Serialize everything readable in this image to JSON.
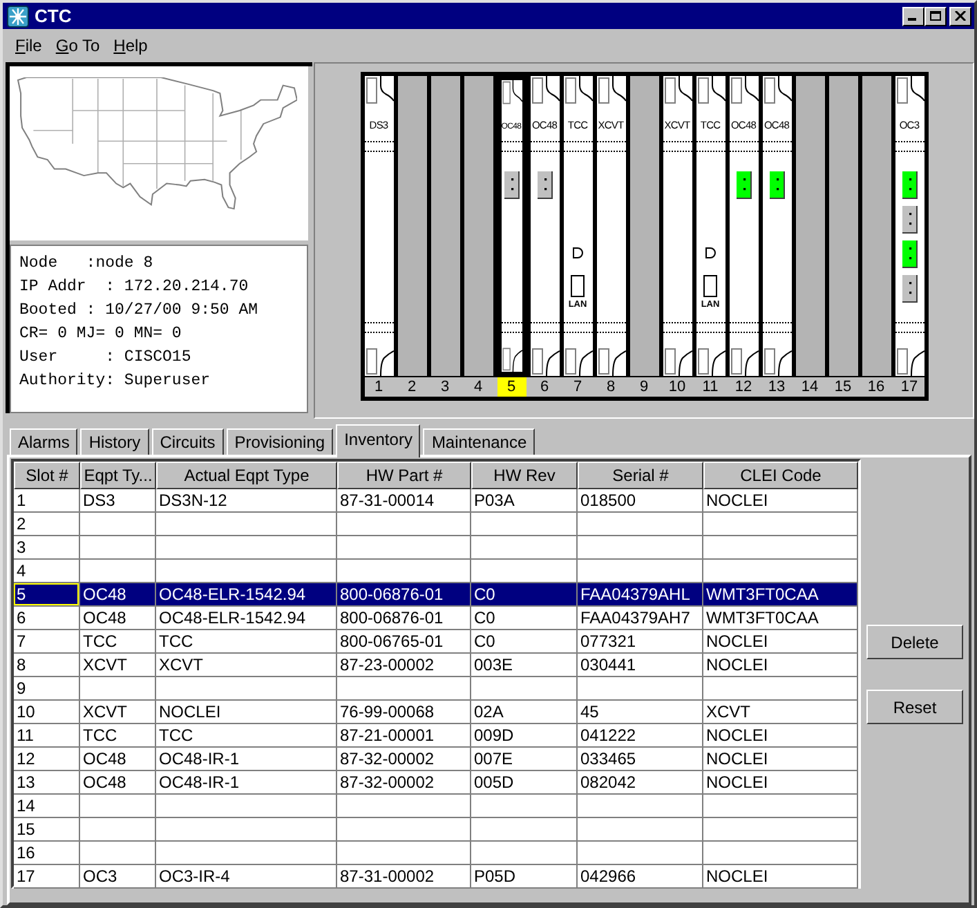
{
  "window": {
    "title": "CTC"
  },
  "menu": [
    "File",
    "Go To",
    "Help"
  ],
  "node_info": [
    "Node   :node 8",
    "IP Addr  : 172.20.214.70",
    "Booted : 10/27/00 9:50 AM",
    "CR= 0 MJ= 0 MN= 0",
    "User     : CISCO15",
    "Authority: Superuser"
  ],
  "shelf": {
    "slots": [
      {
        "number": "1",
        "kind": "card",
        "label": "DS3",
        "selected": false
      },
      {
        "number": "2",
        "kind": "empty",
        "selected": false
      },
      {
        "number": "3",
        "kind": "empty",
        "selected": false
      },
      {
        "number": "4",
        "kind": "empty",
        "selected": false
      },
      {
        "number": "5",
        "kind": "card",
        "label": "OC48",
        "selected": true,
        "ports": [
          {
            "lit": false
          }
        ]
      },
      {
        "number": "6",
        "kind": "card",
        "label": "OC48",
        "selected": false,
        "ports": [
          {
            "lit": false
          }
        ]
      },
      {
        "number": "7",
        "kind": "controller",
        "label": "TCC",
        "selected": false,
        "port_label": "LAN"
      },
      {
        "number": "8",
        "kind": "card",
        "label": "XCVT",
        "selected": false
      },
      {
        "number": "9",
        "kind": "empty",
        "selected": false
      },
      {
        "number": "10",
        "kind": "card",
        "label": "XCVT",
        "selected": false
      },
      {
        "number": "11",
        "kind": "controller",
        "label": "TCC",
        "selected": false,
        "port_label": "LAN"
      },
      {
        "number": "12",
        "kind": "card",
        "label": "OC48",
        "selected": false,
        "ports": [
          {
            "lit": true
          }
        ]
      },
      {
        "number": "13",
        "kind": "card",
        "label": "OC48",
        "selected": false,
        "ports": [
          {
            "lit": true
          }
        ]
      },
      {
        "number": "14",
        "kind": "empty",
        "selected": false
      },
      {
        "number": "15",
        "kind": "empty",
        "selected": false
      },
      {
        "number": "16",
        "kind": "empty",
        "selected": false
      },
      {
        "number": "17",
        "kind": "card",
        "label": "OC3",
        "selected": false,
        "ports": [
          {
            "lit": true
          },
          {
            "lit": false
          },
          {
            "lit": true
          },
          {
            "lit": false
          }
        ]
      }
    ]
  },
  "tabs": [
    {
      "label": "Alarms",
      "selected": false
    },
    {
      "label": "History",
      "selected": false
    },
    {
      "label": "Circuits",
      "selected": false
    },
    {
      "label": "Provisioning",
      "selected": false
    },
    {
      "label": "Inventory",
      "selected": true
    },
    {
      "label": "Maintenance",
      "selected": false
    }
  ],
  "table": {
    "columns": [
      "Slot #",
      "Eqpt Ty...",
      "Actual Eqpt Type",
      "HW Part #",
      "HW Rev",
      "Serial #",
      "CLEI Code"
    ],
    "rows": [
      {
        "slot": "1",
        "eqpt_type": "DS3",
        "actual_eqpt_type": "DS3N-12",
        "hw_part": "87-31-00014",
        "hw_rev": "P03A",
        "serial": "018500",
        "clei_code": "NOCLEI",
        "selected": false,
        "focused": false
      },
      {
        "slot": "2",
        "selected": false,
        "focused": false
      },
      {
        "slot": "3",
        "selected": false,
        "focused": false
      },
      {
        "slot": "4",
        "selected": false,
        "focused": false
      },
      {
        "slot": "5",
        "eqpt_type": "OC48",
        "actual_eqpt_type": "OC48-ELR-1542.94",
        "hw_part": "800-06876-01",
        "hw_rev": "C0",
        "serial": "FAA04379AHL",
        "clei_code": "WMT3FT0CAA",
        "selected": true,
        "focused": true
      },
      {
        "slot": "6",
        "eqpt_type": "OC48",
        "actual_eqpt_type": "OC48-ELR-1542.94",
        "hw_part": "800-06876-01",
        "hw_rev": "C0",
        "serial": "FAA04379AH7",
        "clei_code": "WMT3FT0CAA",
        "selected": false,
        "focused": false
      },
      {
        "slot": "7",
        "eqpt_type": "TCC",
        "actual_eqpt_type": "TCC",
        "hw_part": "800-06765-01",
        "hw_rev": "C0",
        "serial": "077321",
        "clei_code": "NOCLEI",
        "selected": false,
        "focused": false
      },
      {
        "slot": "8",
        "eqpt_type": "XCVT",
        "actual_eqpt_type": "XCVT",
        "hw_part": "87-23-00002",
        "hw_rev": "003E",
        "serial": "030441",
        "clei_code": "NOCLEI",
        "selected": false,
        "focused": false
      },
      {
        "slot": "9",
        "selected": false,
        "focused": false
      },
      {
        "slot": "10",
        "eqpt_type": "XCVT",
        "actual_eqpt_type": "NOCLEI",
        "hw_part": "76-99-00068",
        "hw_rev": "02A",
        "serial": "45",
        "clei_code": "XCVT",
        "selected": false,
        "focused": false
      },
      {
        "slot": "11",
        "eqpt_type": "TCC",
        "actual_eqpt_type": "TCC",
        "hw_part": "87-21-00001",
        "hw_rev": "009D",
        "serial": "041222",
        "clei_code": "NOCLEI",
        "selected": false,
        "focused": false
      },
      {
        "slot": "12",
        "eqpt_type": "OC48",
        "actual_eqpt_type": "OC48-IR-1",
        "hw_part": "87-32-00002",
        "hw_rev": "007E",
        "serial": "033465",
        "clei_code": "NOCLEI",
        "selected": false,
        "focused": false
      },
      {
        "slot": "13",
        "eqpt_type": "OC48",
        "actual_eqpt_type": "OC48-IR-1",
        "hw_part": "87-32-00002",
        "hw_rev": "005D",
        "serial": "082042",
        "clei_code": "NOCLEI",
        "selected": false,
        "focused": false
      },
      {
        "slot": "14",
        "selected": false,
        "focused": false
      },
      {
        "slot": "15",
        "selected": false,
        "focused": false
      },
      {
        "slot": "16",
        "selected": false,
        "focused": false
      },
      {
        "slot": "17",
        "eqpt_type": "OC3",
        "actual_eqpt_type": "OC3-IR-4",
        "hw_part": "87-31-00002",
        "hw_rev": "P05D",
        "serial": "042966",
        "clei_code": "NOCLEI",
        "selected": false,
        "focused": false
      }
    ]
  },
  "buttons": [
    "Delete",
    "Reset"
  ]
}
